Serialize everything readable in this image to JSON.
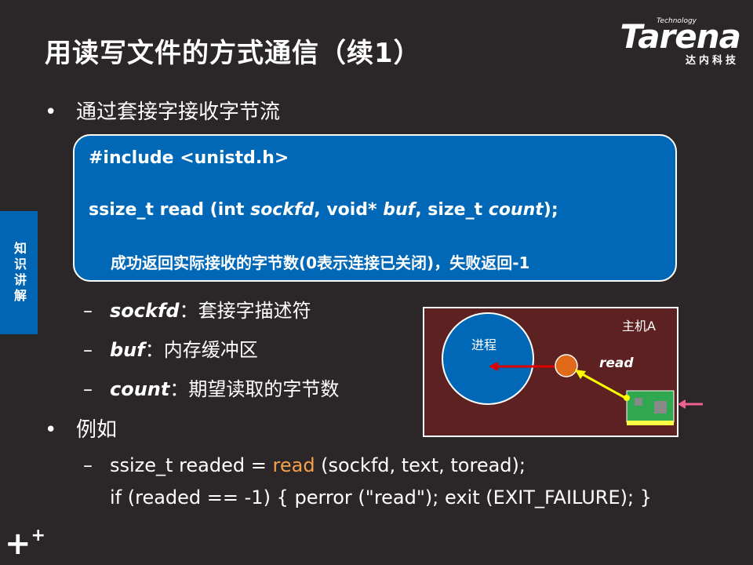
{
  "title": "用读写文件的方式通信（续1）",
  "logo": {
    "tech": "Technology",
    "brand": "Tarena",
    "cn": "达内科技"
  },
  "side_tab": "知识讲解",
  "bullet1": "通过套接字接收字节流",
  "code": {
    "include": "#include <unistd.h>",
    "sig_prefix": "ssize_t read (int ",
    "sig_arg1": "sockfd",
    "sig_mid1": ", void* ",
    "sig_arg2": "buf",
    "sig_mid2": ", size_t ",
    "sig_arg3": "count",
    "sig_suffix": ");",
    "desc": "成功返回实际接收的字节数(0表示连接已关闭)，失败返回-1"
  },
  "params": [
    {
      "name": "sockfd",
      "desc": "：套接字描述符"
    },
    {
      "name": "buf",
      "desc": "：内存缓冲区"
    },
    {
      "name": "count",
      "desc": "：期望读取的字节数"
    }
  ],
  "bullet2": "例如",
  "example": {
    "line1_pre": "ssize_t readed = ",
    "line1_kw": "read",
    "line1_post": " (sockfd, text, toread);",
    "line2": "if (readed == -1) { perror (\"read\"); exit (EXIT_FAILURE); }"
  },
  "diagram": {
    "host_label": "主机A",
    "process_label": "进程",
    "read_label": "read"
  },
  "colors": {
    "background": "#2b2627",
    "code_box": "#0068b6",
    "side_tab": "#0066b3",
    "diagram_bg": "#5e2121",
    "process_circle": "#0068b6",
    "socket_circle": "#e06a1a",
    "arrow_red": "#e00000",
    "arrow_yellow": "#ffff00",
    "nic_green": "#2fa84f",
    "read_keyword": "#f5a04a",
    "pink_arrow": "#f06090"
  }
}
